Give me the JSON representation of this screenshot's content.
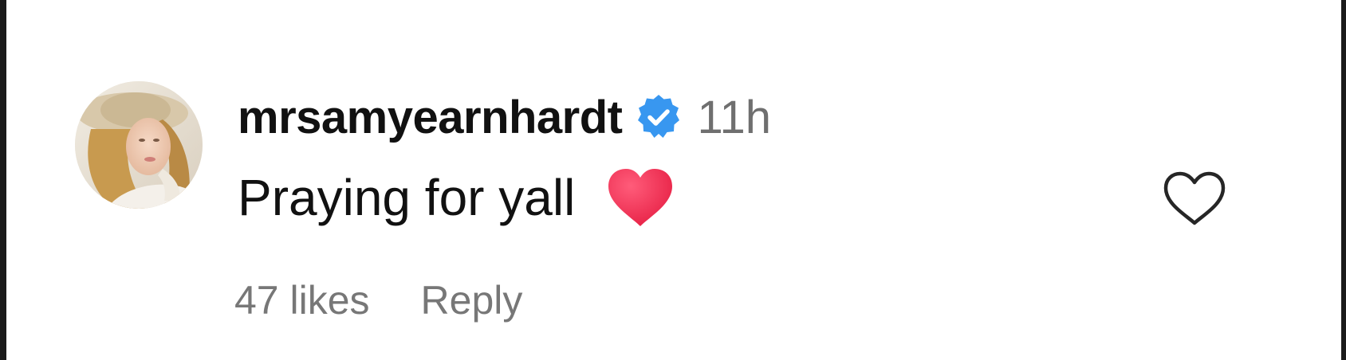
{
  "comment": {
    "username": "mrsamyearnhardt",
    "verified": true,
    "timestamp": "11h",
    "text": "Praying for yall",
    "emoji": "red-heart",
    "likes": "47 likes",
    "reply_label": "Reply"
  },
  "icons": {
    "verified": "verified-badge-icon",
    "like": "heart-outline-icon",
    "emoji": "red-heart-emoji"
  },
  "colors": {
    "verified_blue": "#3897f0",
    "heart_red": "#ef2d4f",
    "username": "#111111",
    "secondary_text": "#777777"
  }
}
